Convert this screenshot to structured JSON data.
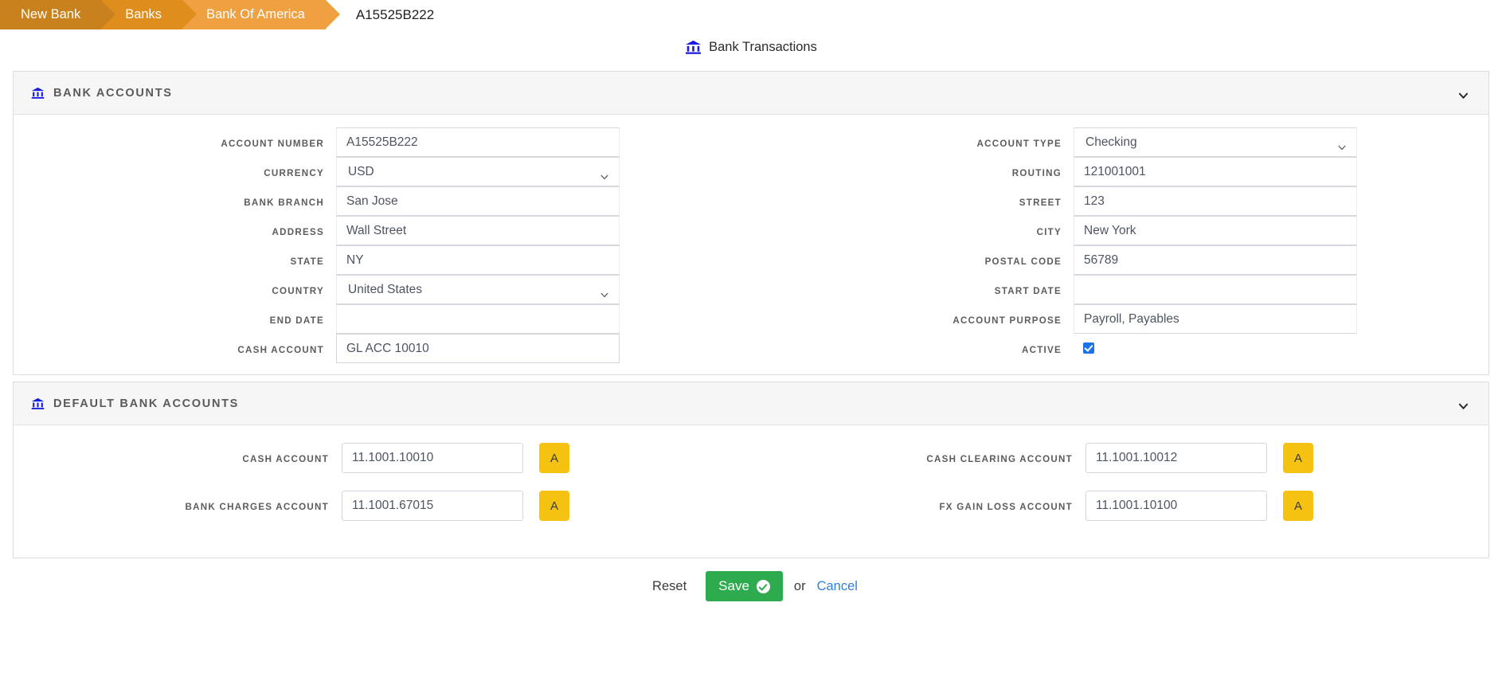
{
  "breadcrumb": {
    "items": [
      {
        "label": "New Bank",
        "color": "#c8811c"
      },
      {
        "label": "Banks",
        "color": "#df8d1c"
      },
      {
        "label": "Bank Of America",
        "color": "#efa040"
      }
    ],
    "current": "A15525B222"
  },
  "page_head": {
    "link_label": "Bank Transactions",
    "icon": "bank-icon"
  },
  "sections": {
    "bank_accounts": {
      "title": "Bank Accounts",
      "icon": "bank-icon",
      "collapse_icon": "chevron-down-icon",
      "left_fields": [
        {
          "label": "Account Number",
          "value": "A15525B222",
          "type": "text"
        },
        {
          "label": "Currency",
          "value": "USD",
          "type": "select"
        },
        {
          "label": "Bank Branch",
          "value": "San Jose",
          "type": "text"
        },
        {
          "label": "Address",
          "value": "Wall Street",
          "type": "text"
        },
        {
          "label": "State",
          "value": "NY",
          "type": "text"
        },
        {
          "label": "Country",
          "value": "United States",
          "type": "select"
        },
        {
          "label": "End Date",
          "value": "",
          "type": "text"
        },
        {
          "label": "Cash Account",
          "value": "GL ACC 10010",
          "type": "text"
        }
      ],
      "right_fields": [
        {
          "label": "Account Type",
          "value": "Checking",
          "type": "select"
        },
        {
          "label": "Routing",
          "value": "121001001",
          "type": "text"
        },
        {
          "label": "Street",
          "value": "123",
          "type": "text"
        },
        {
          "label": "City",
          "value": "New York",
          "type": "text"
        },
        {
          "label": "Postal Code",
          "value": "56789",
          "type": "text"
        },
        {
          "label": "Start Date",
          "value": "",
          "type": "text"
        },
        {
          "label": "Account Purpose",
          "value": "Payroll, Payables",
          "type": "text"
        },
        {
          "label": "Active",
          "value": "",
          "type": "checkbox",
          "checked": true
        }
      ]
    },
    "default_bank_accounts": {
      "title": "Default Bank Accounts",
      "icon": "bank-icon",
      "collapse_icon": "chevron-down-icon",
      "left_fields": [
        {
          "label": "Cash Account",
          "value": "11.1001.10010",
          "button": "A"
        },
        {
          "label": "Bank Charges Account",
          "value": "11.1001.67015",
          "button": "A"
        }
      ],
      "right_fields": [
        {
          "label": "Cash Clearing Account",
          "value": "11.1001.10012",
          "button": "A"
        },
        {
          "label": "FX Gain Loss Account",
          "value": "11.1001.10100",
          "button": "A"
        }
      ]
    }
  },
  "footer": {
    "reset_label": "Reset",
    "save_label": "Save",
    "save_icon": "check-circle-icon",
    "or_label": "or",
    "cancel_label": "Cancel",
    "save_color": "#2eaa4f",
    "cancel_color": "#2f7fe0"
  }
}
